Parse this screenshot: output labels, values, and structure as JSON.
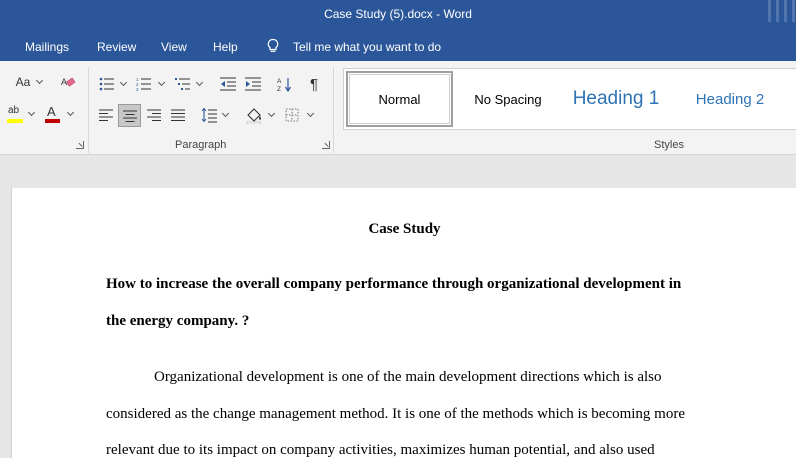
{
  "window": {
    "title": "Case Study (5).docx  -  Word"
  },
  "menu": {
    "items": [
      "Mailings",
      "Review",
      "View",
      "Help"
    ],
    "tell_me": "Tell me what you want to do"
  },
  "ribbon": {
    "font_group": {
      "change_case_label": "Aa",
      "highlight_label": "ab",
      "font_color_label": "A",
      "highlight_color": "#ffff00",
      "font_color": "#c00000"
    },
    "paragraph_group": {
      "label": "Paragraph",
      "pilcrow": "¶"
    },
    "styles_group": {
      "label": "Styles",
      "items": [
        "Normal",
        "No Spacing",
        "Heading 1",
        "Heading 2"
      ],
      "selected": "Normal"
    }
  },
  "document": {
    "title": "Case Study",
    "question_lines": [
      "How to increase the overall company performance through organizational development in",
      "the energy company. ?"
    ],
    "body_lines": [
      "Organizational development is one of the main development directions which is also",
      "considered as the change management method. It is one of the methods which is becoming more",
      "relevant due to its impact on company activities, maximizes human potential, and also used"
    ]
  },
  "colors": {
    "title_bar": "#2b579a",
    "heading_blue": "#2e74b5",
    "ribbon_bg": "#f3f3f3"
  }
}
